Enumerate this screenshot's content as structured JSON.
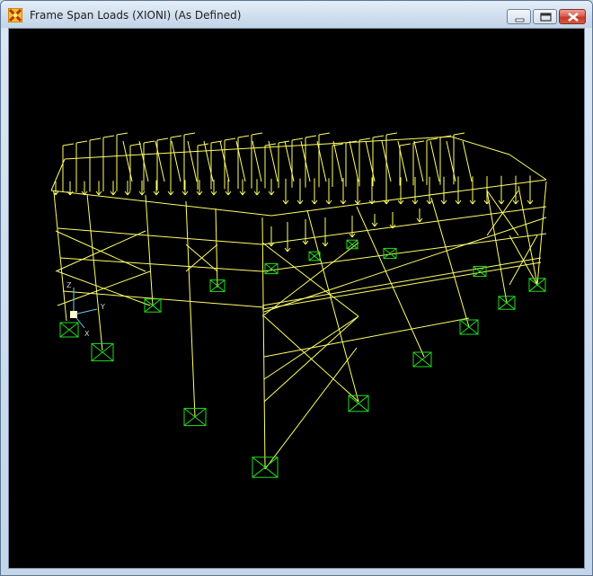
{
  "window": {
    "title": "Frame Span Loads (XIONI) (As Defined)",
    "controls": {
      "minimize": "minimize",
      "maximize": "maximize",
      "close": "close"
    }
  },
  "icons": {
    "app": "sap-app-icon",
    "minimize": "minimize-icon",
    "maximize": "maximize-icon",
    "close": "close-icon"
  },
  "view": {
    "background": "#000000",
    "frame_color": "#ffff66",
    "load_color": "#ffff66",
    "support_color": "#22dd22",
    "axes": {
      "z_label": "Z",
      "y_label": "Y",
      "x_label": "X",
      "color": "#66ccff"
    }
  }
}
